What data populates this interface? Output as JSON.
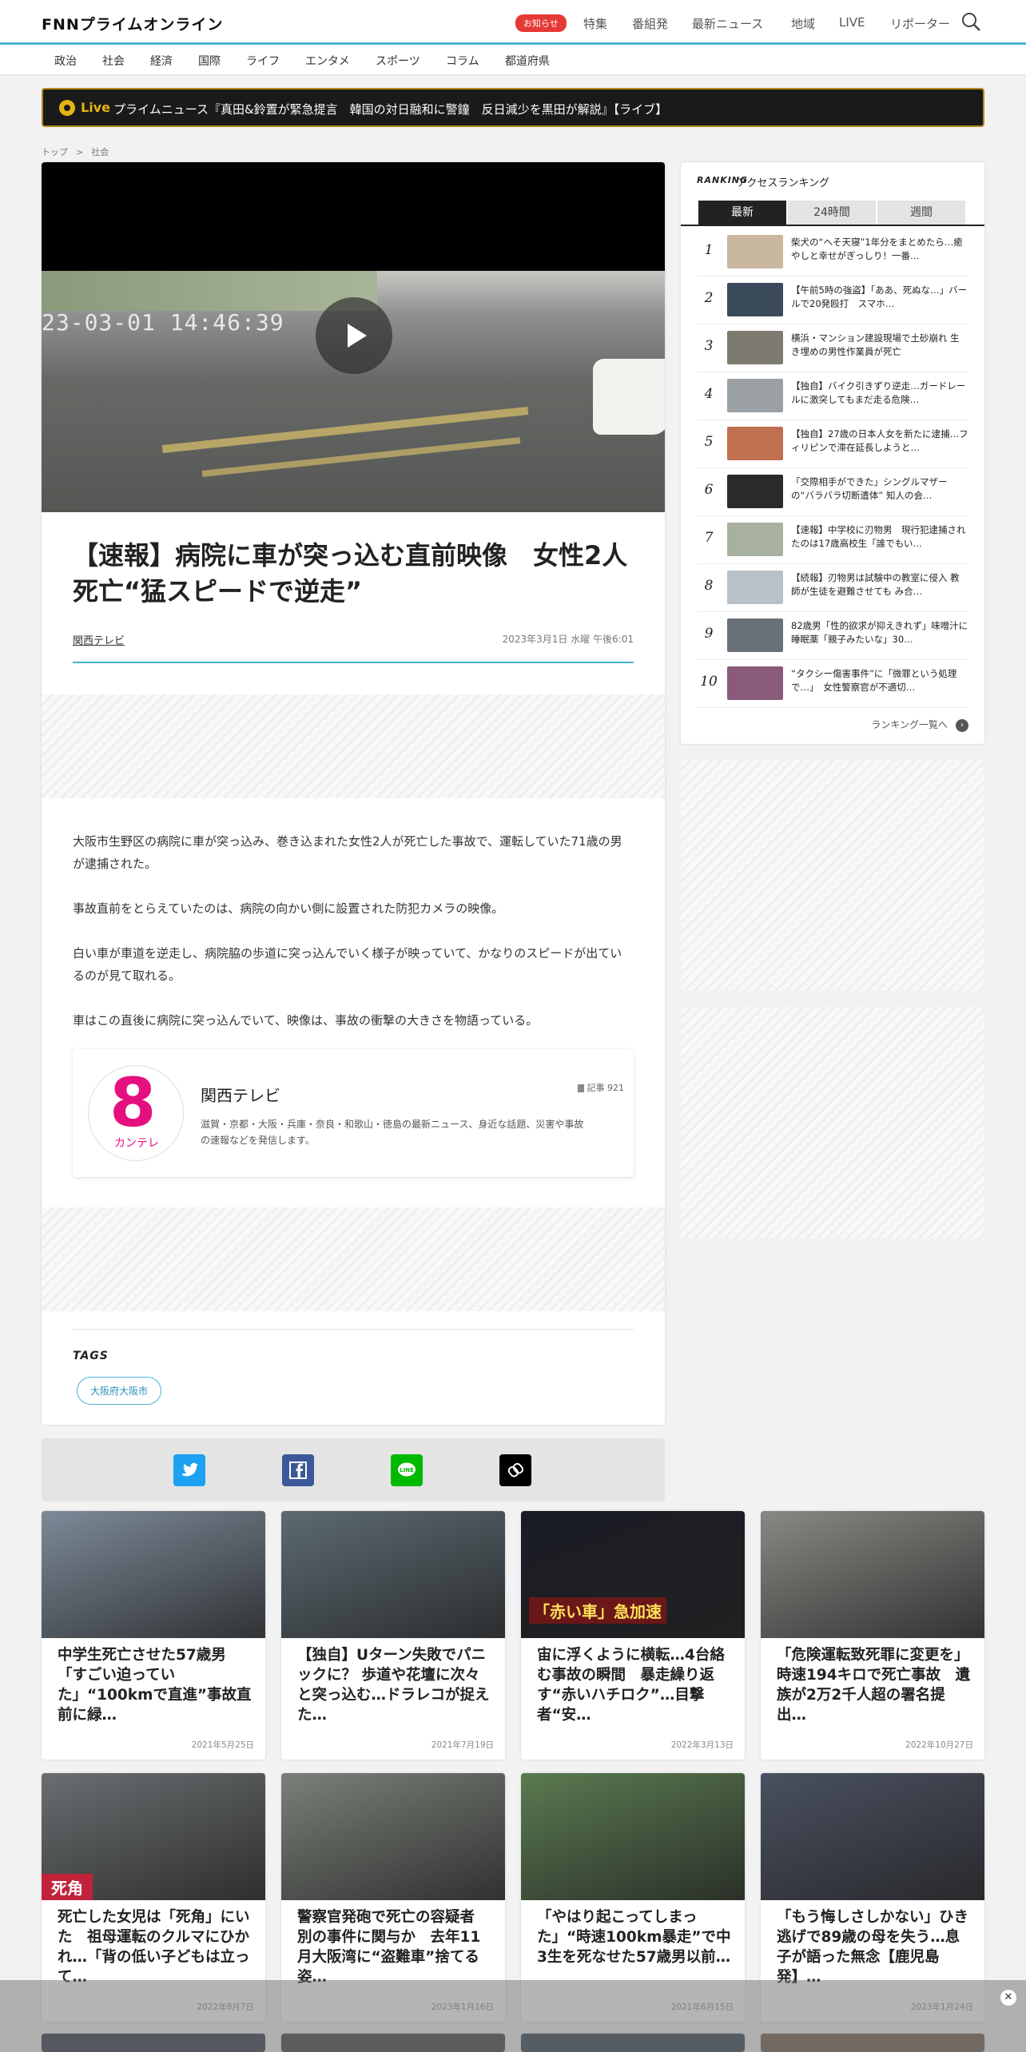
{
  "header": {
    "logo": "FNNプライムオンライン",
    "notice_badge": "お知らせ",
    "nav": [
      "特集",
      "番組発",
      "最新ニュース",
      "地域",
      "LIVE",
      "リポーター"
    ]
  },
  "categories": [
    "政治",
    "社会",
    "経済",
    "国際",
    "ライフ",
    "エンタメ",
    "スポーツ",
    "コラム",
    "都道府県"
  ],
  "live_banner": {
    "tag": "Live",
    "text": "プライムニュース『真田&鈴置が緊急提言　韓国の対日融和に警鐘　反日減少を黒田が解説』【ライブ】"
  },
  "breadcrumb": [
    "トップ",
    ">",
    "社会"
  ],
  "article": {
    "video_timestamp": "23-03-01 14:46:39",
    "title": "【速報】病院に車が突っ込む直前映像　女性2人死亡“猛スピードで逆走”",
    "source": "関西テレビ",
    "date": "2023年3月1日 水曜 午後6:01",
    "paragraphs": [
      "大阪市生野区の病院に車が突っ込み、巻き込まれた女性2人が死亡した事故で、運転していた71歳の男が逮捕された。",
      "事故直前をとらえていたのは、病院の向かい側に設置された防犯カメラの映像。",
      "白い車が車道を逆走し、病院脇の歩道に突っ込んでいく様子が映っていて、かなりのスピードが出ているのが見て取れる。",
      "車はこの直後に病院に突っ込んでいて、映像は、事故の衝撃の大きさを物語っている。"
    ],
    "publisher": {
      "logo_mark": "8",
      "logo_kana": "カンテレ",
      "name": "関西テレビ",
      "count": "記事 921",
      "description": "滋賀・京都・大阪・兵庫・奈良・和歌山・徳島の最新ニュース、身近な話題、災害や事故の速報などを発信します。"
    },
    "tags_heading": "TAGS",
    "tags": [
      "大阪府大阪市"
    ]
  },
  "share": [
    "twitter",
    "facebook",
    "line",
    "copy-link"
  ],
  "ranking": {
    "logo": "RANKING",
    "title": "アクセスランキング",
    "tabs": [
      "最新",
      "24時間",
      "週間"
    ],
    "items": [
      {
        "rank": "1",
        "text": "柴犬の“ヘそ天寝”1年分をまとめたら…癒やしと幸せがぎっしり！一番…",
        "color": "#c9b7a0"
      },
      {
        "rank": "2",
        "text": "【午前5時の強盗】「ああ、死ぬな…」バールで20発殴打　スマホ…",
        "color": "#3a4a5a"
      },
      {
        "rank": "3",
        "text": "横浜・マンション建設現場で土砂崩れ 生き埋めの男性作業員が死亡",
        "color": "#7d7a70"
      },
      {
        "rank": "4",
        "text": "【独自】バイク引きずり逆走…ガードレールに激突してもまだ走る危険…",
        "color": "#9aa0a4"
      },
      {
        "rank": "5",
        "text": "【独自】27歳の日本人女を新たに逮捕…フィリピンで滞在延長しようと…",
        "color": "#c07050"
      },
      {
        "rank": "6",
        "text": "「交際相手ができた」シングルマザーの“バラバラ切断遺体” 知人の会…",
        "color": "#2a2a2a"
      },
      {
        "rank": "7",
        "text": "【速報】中学校に刃物男　現行犯逮捕されたのは17歳高校生「誰でもい…",
        "color": "#a8b0a0"
      },
      {
        "rank": "8",
        "text": "【続報】刃物男は試験中の教室に侵入 教師が生徒を避難させても み合…",
        "color": "#b8c0c8"
      },
      {
        "rank": "9",
        "text": "82歳男「性的欲求が抑えきれず」味噌汁に睡眠薬「親子みたいな」30…",
        "color": "#6a7078"
      },
      {
        "rank": "10",
        "text": "“タクシー傷害事件”に「微罪という処理で…」　女性警察官が不適切…",
        "color": "#8a5a7a"
      }
    ],
    "more": "ランキング一覧へ"
  },
  "related": [
    {
      "title": "中学生死亡させた57歳男「すごい迫っていた」“100kmで直進”事故直前に緑…",
      "date": "2021年5月25日",
      "color": "#7c8a98",
      "overlay": ""
    },
    {
      "title": "【独自】Uターン失敗でパニックに？ 歩道や花壇に次々と突っ込む…ドラレコが捉えた…",
      "date": "2021年7月19日",
      "color": "#5c6a72",
      "overlay": ""
    },
    {
      "title": "宙に浮くように横転…4台絡む事故の瞬間　暴走繰り返す“赤いハチロク”…目撃者“安…",
      "date": "2022年3月13日",
      "color": "#1a1c24",
      "overlay": "「赤い車」急加速"
    },
    {
      "title": "「危険運転致死罪に変更を」時速194キロで死亡事故　遺族が2万2千人超の署名提出…",
      "date": "2022年10月27日",
      "color": "#8a8884",
      "overlay": ""
    },
    {
      "title": "死亡した女児は「死角」にいた　祖母運転のクルマにひかれ…「背の低い子どもは立って…",
      "date": "2022年8月7日",
      "color": "#6a6e70",
      "overlay": "死角"
    },
    {
      "title": "警察官発砲で死亡の容疑者 別の事件に関与か　去年11月大阪湾に“盗難車”捨てる姿…",
      "date": "2023年1月16日",
      "color": "#7a8078",
      "overlay": ""
    },
    {
      "title": "「やはり起こってしまった」“時速100km暴走”で中3生を死なせた57歳男以前…",
      "date": "2021年6月15日",
      "color": "#5a7a50",
      "overlay": ""
    },
    {
      "title": "「もう悔しさしかない」ひき逃げで89歳の母を失う…息子が語った無念【鹿児島発】…",
      "date": "2023年1月24日",
      "color": "#4a5060",
      "overlay": ""
    }
  ]
}
